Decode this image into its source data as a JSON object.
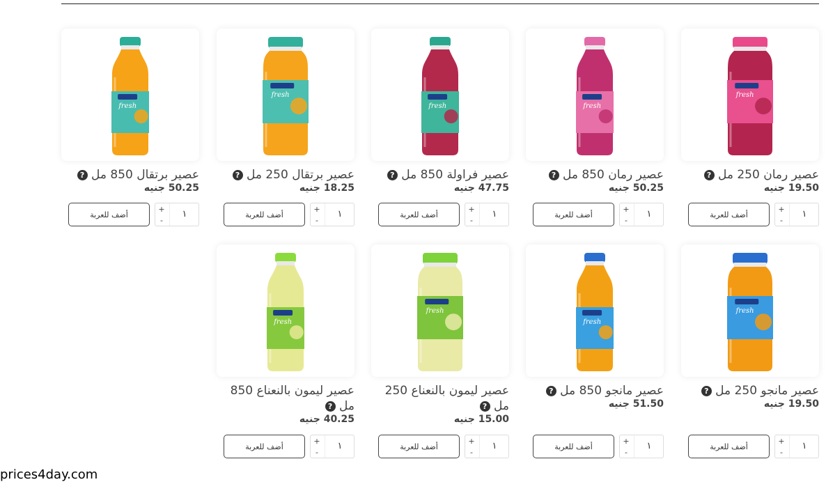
{
  "currency": "جنيه",
  "add_label": "أضف للعربة",
  "qty_default": "١",
  "footer": "prices4day.com",
  "products": [
    {
      "name": "عصير رمان 250 مل",
      "price": "19.50",
      "bottle": "small",
      "liquid": "#b3244f",
      "cap": "#e84a8a",
      "label": "#e8508e"
    },
    {
      "name": "عصير رمان 850 مل",
      "price": "50.25",
      "bottle": "tall",
      "liquid": "#c0306e",
      "cap": "#e36aa8",
      "label": "#e770a8"
    },
    {
      "name": "عصير فراولة 850 مل",
      "price": "47.75",
      "bottle": "tall",
      "liquid": "#b2294c",
      "cap": "#2aa88f",
      "label": "#3fb59b"
    },
    {
      "name": "عصير برتقال 250 مل",
      "price": "18.25",
      "bottle": "small",
      "liquid": "#f5a41c",
      "cap": "#33b09b",
      "label": "#4dbfb0"
    },
    {
      "name": "عصير برتقال 850 مل",
      "price": "50.25",
      "bottle": "tall",
      "liquid": "#f6a318",
      "cap": "#2aae98",
      "label": "#49bcb0"
    },
    {
      "name": "عصير مانجو 250 مل",
      "price": "19.50",
      "bottle": "small",
      "liquid": "#f29a14",
      "cap": "#2a6fd0",
      "label": "#3a9be0"
    },
    {
      "name": "عصير مانجو 850 مل",
      "price": "51.50",
      "bottle": "tall",
      "liquid": "#f3a114",
      "cap": "#2a6fd0",
      "label": "#3aa0e0"
    },
    {
      "name": "عصير ليمون بالنعناع 250 مل",
      "price": "15.00",
      "bottle": "small",
      "liquid": "#e8eaa6",
      "cap": "#7ed23a",
      "label": "#7ec43c"
    },
    {
      "name": "عصير ليمون بالنعناع 850 مل",
      "price": "40.25",
      "bottle": "tall",
      "liquid": "#e6e994",
      "cap": "#8cdb3c",
      "label": "#86c93e"
    }
  ]
}
